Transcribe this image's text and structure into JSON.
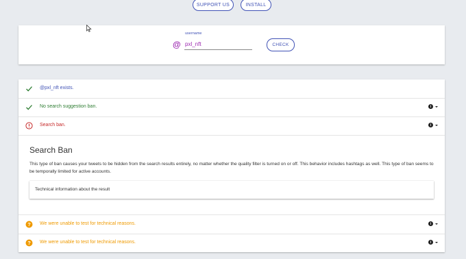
{
  "header": {
    "support_label": "SUPPORT US",
    "install_label": "INSTALL"
  },
  "form": {
    "username_label": "username",
    "at_symbol": "@",
    "username_value": "pxl_nft",
    "check_label": "CHECK"
  },
  "results": [
    {
      "status": "success",
      "text": "@pxl_nft exists.",
      "has_info": false
    },
    {
      "status": "success",
      "text": "No search suggestion ban.",
      "has_info": true
    },
    {
      "status": "error",
      "text": "Search ban.",
      "has_info": true
    },
    {
      "status": "unknown",
      "text": "We were unable to test for technical reasons.",
      "has_info": true
    },
    {
      "status": "unknown",
      "text": "We were unable to test for technical reasons.",
      "has_info": true
    }
  ],
  "detail": {
    "title": "Search Ban",
    "description": "This type of ban causes your tweets to be hidden from the search results entirely, no matter whether the quality filter is turned on or off. This behavior includes hashtags as well. This type of ban seems to be temporally limited for active accounts.",
    "technical_label": "Technical information about the result"
  },
  "colors": {
    "accent": "#3f51b5",
    "success": "#2e7d32",
    "error": "#c62828",
    "warning": "#ef9a00",
    "username": "#9c27b0"
  },
  "icons": {
    "success": "check-icon",
    "error": "alert-circle-icon",
    "unknown": "help-circle-icon",
    "info": "info-icon",
    "dropdown": "caret-down-icon"
  }
}
